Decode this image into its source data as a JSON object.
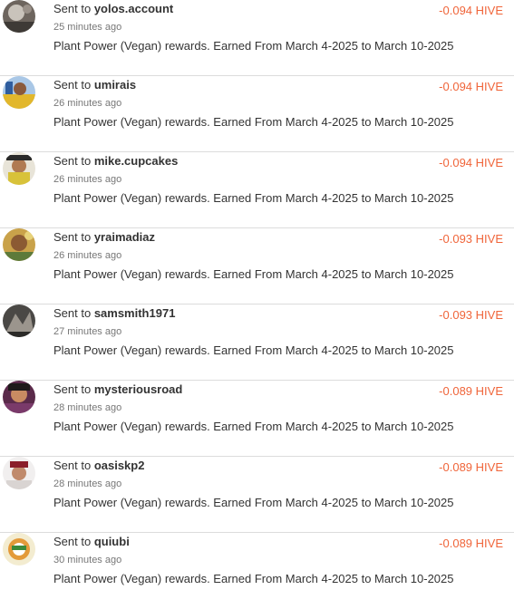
{
  "accent_color": "#f0653a",
  "transfers": [
    {
      "prefix": "Sent to ",
      "user": "yolos.account",
      "time": "25 minutes ago",
      "memo": "Plant Power (Vegan) rewards. Earned From March 4-2025 to March 10-2025",
      "amount": "-0.094 HIVE"
    },
    {
      "prefix": "Sent to ",
      "user": "umirais",
      "time": "26 minutes ago",
      "memo": "Plant Power (Vegan) rewards. Earned From March 4-2025 to March 10-2025",
      "amount": "-0.094 HIVE"
    },
    {
      "prefix": "Sent to ",
      "user": "mike.cupcakes",
      "time": "26 minutes ago",
      "memo": "Plant Power (Vegan) rewards. Earned From March 4-2025 to March 10-2025",
      "amount": "-0.094 HIVE"
    },
    {
      "prefix": "Sent to ",
      "user": "yraimadiaz",
      "time": "26 minutes ago",
      "memo": "Plant Power (Vegan) rewards. Earned From March 4-2025 to March 10-2025",
      "amount": "-0.093 HIVE"
    },
    {
      "prefix": "Sent to ",
      "user": "samsmith1971",
      "time": "27 minutes ago",
      "memo": "Plant Power (Vegan) rewards. Earned From March 4-2025 to March 10-2025",
      "amount": "-0.093 HIVE"
    },
    {
      "prefix": "Sent to ",
      "user": "mysteriousroad",
      "time": "28 minutes ago",
      "memo": "Plant Power (Vegan) rewards. Earned From March 4-2025 to March 10-2025",
      "amount": "-0.089 HIVE"
    },
    {
      "prefix": "Sent to ",
      "user": "oasiskp2",
      "time": "28 minutes ago",
      "memo": "Plant Power (Vegan) rewards. Earned From March 4-2025 to March 10-2025",
      "amount": "-0.089 HIVE"
    },
    {
      "prefix": "Sent to ",
      "user": "quiubi",
      "time": "30 minutes ago",
      "memo": "Plant Power (Vegan) rewards. Earned From March 4-2025 to March 10-2025",
      "amount": "-0.089 HIVE"
    }
  ]
}
